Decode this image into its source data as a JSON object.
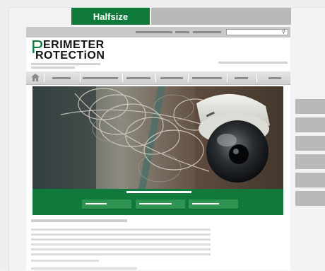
{
  "tabs": {
    "active_label": "Halfsize",
    "inactive_label": ""
  },
  "site": {
    "logo_line1": "ERIMETER",
    "logo_line2": "ROTECTiON",
    "logo_initial": "P"
  },
  "colors": {
    "brand_green": "#0f7a3a",
    "placeholder_gray": "#b9b9b9"
  },
  "icons": {
    "search": "magnifier",
    "home": "house"
  }
}
